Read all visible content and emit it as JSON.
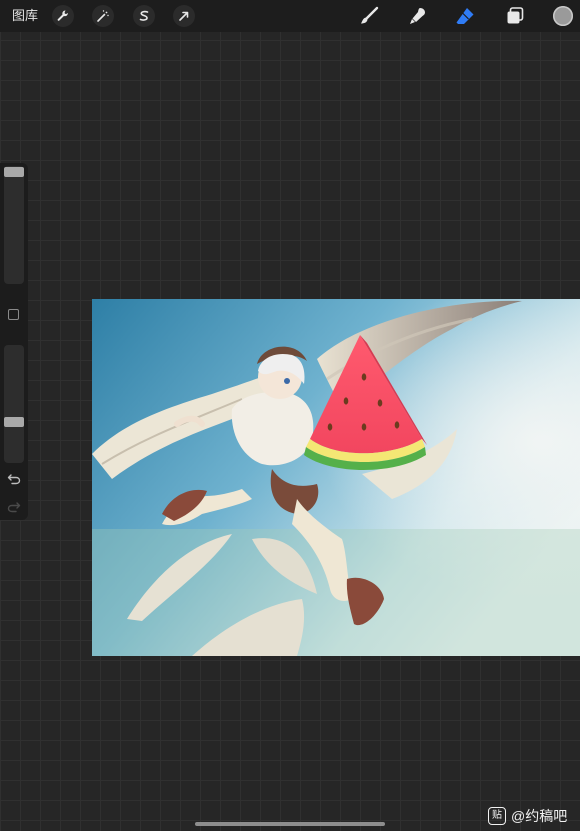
{
  "toolbar": {
    "gallery_label": "图库",
    "left_tools": [
      "wrench-icon",
      "magic-wand-icon",
      "selection-icon",
      "transform-arrow-icon"
    ],
    "right_tools": [
      "brush-icon",
      "smudge-icon",
      "eraser-icon",
      "layers-icon"
    ],
    "active_tool": "eraser-icon",
    "accent_color": "#2f7cf6",
    "current_color": "#9a9a9a"
  },
  "sidebar": {
    "brush_size_level": 0.0,
    "opacity_level": 0.75,
    "modify_button": "square-modify-icon",
    "undo": "undo-icon",
    "redo": "redo-icon"
  },
  "canvas": {
    "artwork": "illustration-winged-boy-with-watermelon",
    "sky_color": "#5aa0c4"
  },
  "watermark": {
    "logo_text": "贴",
    "text": "@约稿吧"
  }
}
